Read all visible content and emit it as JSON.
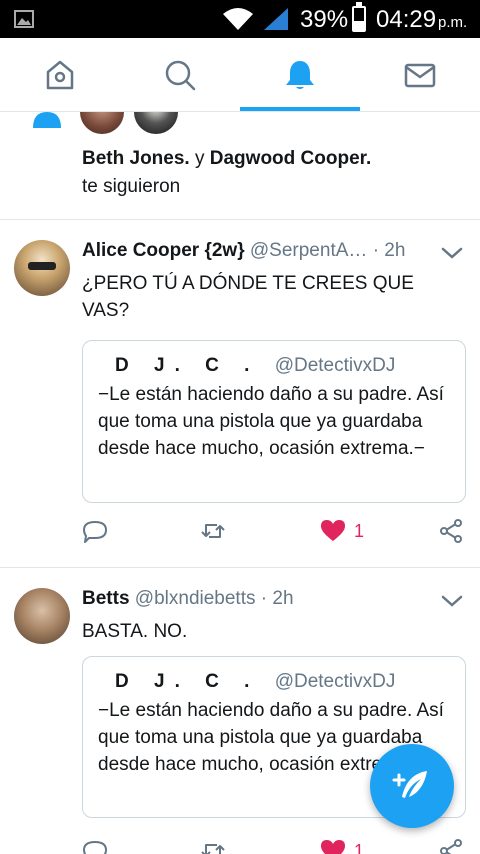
{
  "status_bar": {
    "battery_percent": "39%",
    "battery_level": 0.39,
    "time": "04:29",
    "ampm": "p.m."
  },
  "tabs": [
    {
      "name": "home",
      "icon": "home-icon",
      "active": false
    },
    {
      "name": "search",
      "icon": "search-icon",
      "active": false
    },
    {
      "name": "notifications",
      "icon": "bell-icon",
      "active": true
    },
    {
      "name": "messages",
      "icon": "mail-icon",
      "active": false
    }
  ],
  "colors": {
    "accent": "#1da1f2",
    "like": "#e0245e",
    "secondary_text": "#657786",
    "divider": "#e1e8ed"
  },
  "follow_notification": {
    "icon": "person-icon",
    "name1": "Beth Jones.",
    "conjunction": "y",
    "name2": "Dagwood Cooper.",
    "text": "te siguieron"
  },
  "tweets": [
    {
      "name": "Alice Cooper {2w}",
      "handle": "@SerpentA…",
      "separator": "·",
      "age": "2h",
      "text": "¿PERO TÚ A DÓNDE TE CREES QUE VAS?",
      "quote": {
        "name": "D J. C .",
        "handle": "@DetectivxDJ",
        "text": "−Le están haciendo daño a su padre. Así que toma una pistola que ya guardaba desde hace mucho, ocasión extrema.−"
      },
      "likes": "1",
      "liked": true
    },
    {
      "name": "Betts",
      "handle": "@blxndiebetts",
      "separator": "·",
      "age": "2h",
      "text": "BASTA. NO.",
      "quote": {
        "name": "D J. C .",
        "handle": "@DetectivxDJ",
        "text": "−Le están haciendo daño a su padre. Así que toma una pistola que ya guardaba desde hace mucho, ocasión extrema.−"
      },
      "likes": "1",
      "liked": true
    }
  ],
  "fab": {
    "icon": "compose-tweet-icon"
  }
}
